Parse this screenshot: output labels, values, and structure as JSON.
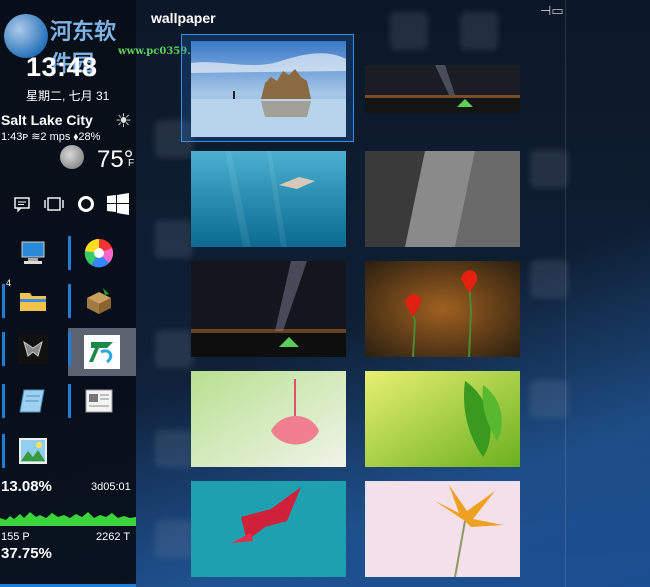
{
  "watermark": {
    "brand": "河东软件园",
    "url": "www.pc0359.cn"
  },
  "sidebar": {
    "time": "13:48",
    "date": "星期二, 七月 31",
    "city": "Salt Lake City",
    "weather_line": "1:43ᴘ ≋2 mps ⬧28%",
    "temperature": "75°",
    "temp_unit": "F",
    "apps_badge": "4",
    "cpu_percent": "13.08%",
    "uptime": "3d05:01",
    "left_stat": "155 P",
    "right_stat": "2262 T",
    "mem_percent": "37.75%"
  },
  "panel": {
    "title": "wallpaper",
    "wallpapers": [
      {
        "name": "beach-rocks",
        "selected": true
      },
      {
        "name": "milky-way-tent"
      },
      {
        "name": "underwater-swimmer"
      },
      {
        "name": "rock-cliff-bw"
      },
      {
        "name": "milky-way-tent-2"
      },
      {
        "name": "red-tulips"
      },
      {
        "name": "pink-flower-green"
      },
      {
        "name": "green-leaf"
      },
      {
        "name": "red-flower-teal"
      },
      {
        "name": "orange-flower-pink"
      }
    ]
  },
  "colors": {
    "accent": "#1f7fd8",
    "selection": "#3a8ee6",
    "graph_green": "#3cd43c"
  }
}
